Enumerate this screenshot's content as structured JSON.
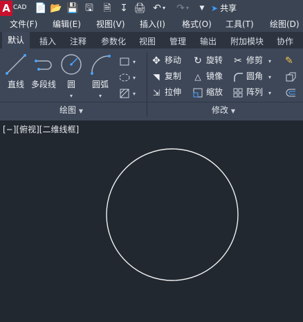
{
  "app": {
    "logo_letter": "A",
    "logo_text": "CAD",
    "share_label": "共享"
  },
  "quick_access": [
    "new-icon",
    "open-icon",
    "save-icon",
    "saveas-icon",
    "publish-icon",
    "import-icon",
    "print-icon",
    "undo-icon",
    "redo-icon",
    "customize-dropdown-icon"
  ],
  "menu": [
    "文件(F)",
    "编辑(E)",
    "视图(V)",
    "插入(I)",
    "格式(O)",
    "工具(T)",
    "绘图(D)"
  ],
  "tabs": [
    "默认",
    "插入",
    "注释",
    "参数化",
    "视图",
    "管理",
    "输出",
    "附加模块",
    "协作"
  ],
  "active_tab": "默认",
  "draw_panel": {
    "title": "绘图",
    "tools": [
      "直线",
      "多段线",
      "圆",
      "圆弧"
    ]
  },
  "modify_panel": {
    "title": "修改",
    "rows": [
      [
        "移动",
        "旋转",
        "修剪"
      ],
      [
        "复制",
        "镜像",
        "圆角"
      ],
      [
        "拉伸",
        "缩放",
        "阵列"
      ]
    ]
  },
  "viewport": {
    "label": "[−][俯视][二维线框]"
  },
  "colors": {
    "background": "#212830",
    "ribbon": "#3d4758",
    "accent_red": "#c8102e",
    "share_blue": "#3aa0ff"
  }
}
